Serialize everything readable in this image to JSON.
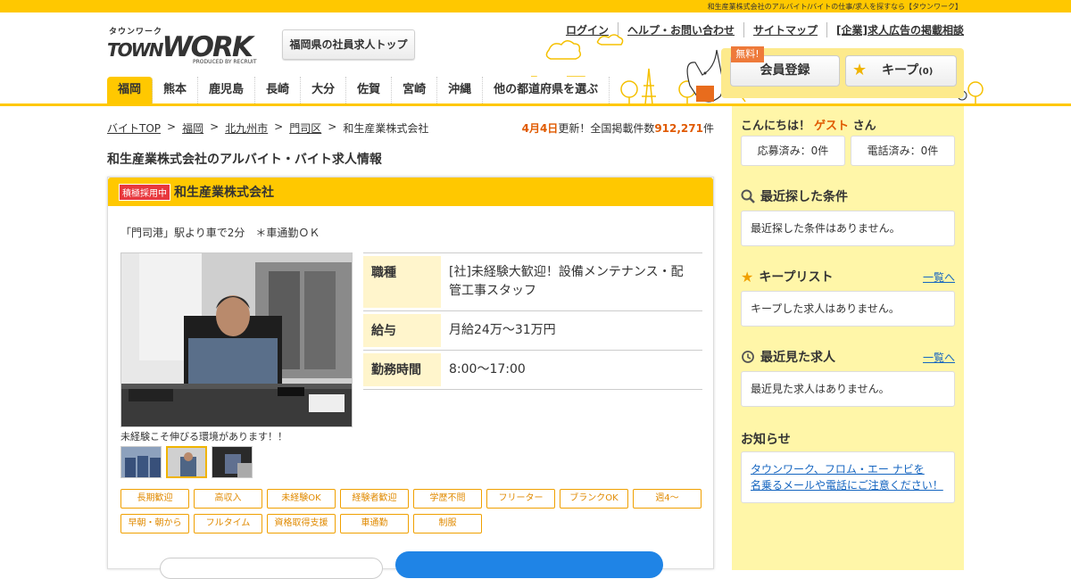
{
  "topbar": {
    "text": "和生産業株式会社のアルバイト/バイトの仕事/求人を探すなら【タウンワーク】"
  },
  "logo": {
    "kana": "タウンワーク",
    "word_a": "TOWN",
    "word_b": "WORK",
    "produced": "PRODUCED BY RECRUIT"
  },
  "header": {
    "pref_top": "福岡県の社員求人トップ",
    "links": [
      "ログイン",
      "ヘルプ・お問い合わせ",
      "サイトマップ",
      "[企業]求人広告の掲載相談"
    ],
    "free": "無料!",
    "register": "会員登録",
    "keep": "キープ",
    "keep_count": "(0)"
  },
  "regions": [
    "福岡",
    "熊本",
    "鹿児島",
    "長崎",
    "大分",
    "佐賀",
    "宮崎",
    "沖縄",
    "他の都道府県を選ぶ"
  ],
  "breadcrumb": [
    "バイトTOP",
    "福岡",
    "北九州市",
    "門司区",
    "和生産業株式会社"
  ],
  "update": {
    "date": "4月4日",
    "mid": "更新！全国掲載件数",
    "count": "912,271",
    "unit": "件"
  },
  "page_title": "和生産業株式会社のアルバイト・バイト求人情報",
  "job": {
    "badge": "積極採用中",
    "company": "和生産業株式会社",
    "access": "「門司港」駅より車で2分　＊車通勤ＯＫ",
    "photo_caption": "未経験こそ伸びる環境があります！！",
    "details": [
      {
        "label": "職種",
        "value": "[社]未経験大歓迎！設備メンテナンス・配管工事スタッフ"
      },
      {
        "label": "給与",
        "value": "月給24万～31万円"
      },
      {
        "label": "勤務時間",
        "value": "8:00～17:00"
      }
    ],
    "tags": [
      "長期歓迎",
      "高収入",
      "未経験OK",
      "経験者歓迎",
      "学歴不問",
      "フリーター",
      "ブランクOK",
      "週4～",
      "早朝・朝から",
      "フルタイム",
      "資格取得支援",
      "車通勤",
      "制服"
    ]
  },
  "sidebar": {
    "greeting": "こんにちは！",
    "guest": "ゲスト",
    "san": "さん",
    "applied": "応募済み：0件",
    "called": "電話済み：0件",
    "recent_search_title": "最近探した条件",
    "recent_search_empty": "最近探した条件はありません。",
    "keep_title": "キープリスト",
    "keep_more": "一覧へ",
    "keep_empty": "キープした求人はありません。",
    "viewed_title": "最近見た求人",
    "viewed_more": "一覧へ",
    "viewed_empty": "最近見た求人はありません。",
    "notice_title": "お知らせ",
    "notice_link1": "タウンワーク、フロム・エー ナビを",
    "notice_link2": "名乗るメールや電話にご注意ください！"
  },
  "colors": {
    "brand": "#ffc800",
    "accent": "#e05a00",
    "sidebar": "#fff6a8",
    "apply": "#1f84e6"
  }
}
